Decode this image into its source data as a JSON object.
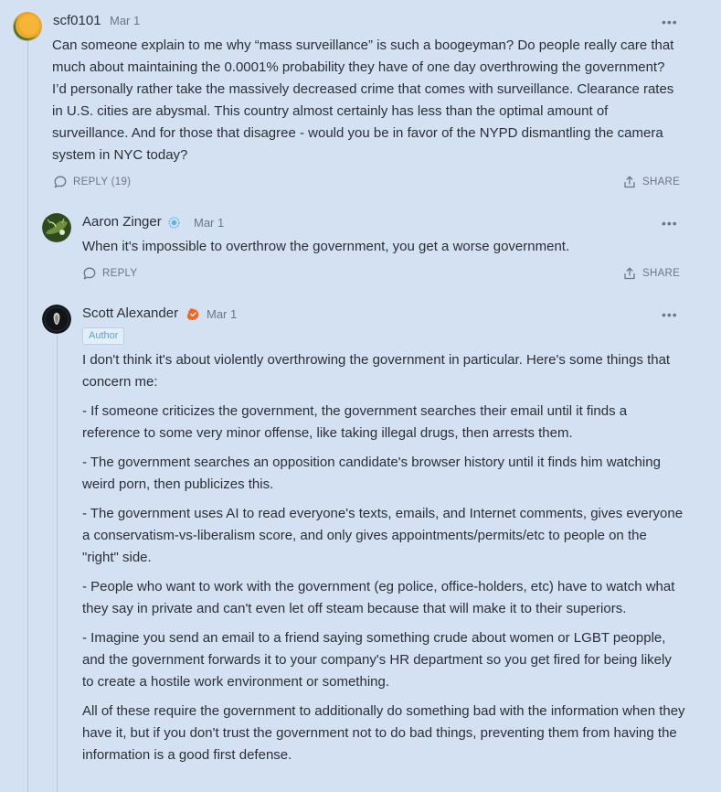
{
  "comments": [
    {
      "author": "scf0101",
      "date": "Mar 1",
      "more_label": "•••",
      "body": [
        "Can someone explain to me why “mass surveillance” is such a boogeyman? Do people really care that much about maintaining the 0.0001% probability they have of one day overthrowing the government? I’d personally rather take the massively decreased crime that comes with surveillance. Clearance rates in U.S. cities are abysmal. This country almost certainly has less than the optimal amount of surveillance. And for those that disagree - would you be in favor of the NYPD dismantling the camera system in NYC today?"
      ],
      "reply_label": "REPLY (19)",
      "share_label": "SHARE",
      "avatar_icon": "orange-green-circle-avatar"
    },
    {
      "author": "Aaron Zinger",
      "date": "Mar 1",
      "more_label": "•••",
      "body": [
        "When it's impossible to overthrow the government, you get a worse government."
      ],
      "reply_label": "REPLY",
      "share_label": "SHARE",
      "avatar_icon": "green-illustration-avatar",
      "badge_icon": "blue-subscriber-badge"
    },
    {
      "author": "Scott Alexander",
      "date": "Mar 1",
      "more_label": "•••",
      "author_tag": "Author",
      "body": [
        "I don't think it's about violently overthrowing the government in particular. Here's some things that concern me:",
        "- If someone criticizes the government, the government searches their email until it finds a reference to some very minor offense, like taking illegal drugs, then arrests them.",
        "- The government searches an opposition candidate's browser history until it finds him watching weird porn, then publicizes this.",
        "- The government uses AI to read everyone's texts, emails, and Internet comments, gives everyone a conservatism-vs-liberalism score, and only gives appointments/permits/etc to people on the \"right\" side.",
        "- People who want to work with the government (eg police, office-holders, etc) have to watch what they say in private and can't even let off steam because that will make it to their superiors.",
        "- Imagine you send an email to a friend saying something crude about women or LGBT peopple, and the government forwards it to your company's HR department so you get fired for being likely to create a hostile work environment or something.",
        "All of these require the government to additionally do something bad with the information when they have it, but if you don't trust the government not to do bad things, preventing them from having the information is a good first defense."
      ],
      "avatar_icon": "dark-circle-avatar",
      "badge_icon": "orange-verified-badge"
    }
  ],
  "colors": {
    "background": "#d3e1f2",
    "text": "#2b2f36",
    "muted": "#6f7580",
    "author_badge": "#5fa0d6",
    "verified": "#f26522"
  }
}
